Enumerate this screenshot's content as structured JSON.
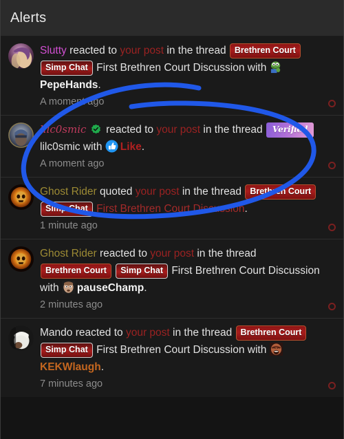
{
  "header": {
    "title": "Alerts"
  },
  "colors": {
    "background": "#1a1a1a",
    "header_background": "#2b2b2b",
    "text": "#e2e2e2",
    "muted_text": "#8c8c8c",
    "your_post_red": "#9b2222",
    "badge_brethren_red": "#a81d1d",
    "badge_verified_purple": "#b06fd6",
    "annotation_blue": "#2058e8",
    "unread_ring": "#7a2020"
  },
  "annotation": {
    "shape": "hand-drawn-ellipse",
    "color": "#2058e8",
    "targets_row_index": 1
  },
  "alerts": [
    {
      "id": "alert-1",
      "avatar_name": "avatar-slutty",
      "username": "Slutty",
      "username_color": "#d14fd1",
      "username_style": "pink",
      "verified": false,
      "action": "reacted to",
      "object": "your post",
      "in_thread": "in the thread",
      "badges": [
        {
          "label": "Brethren Court",
          "style": "brethren"
        },
        {
          "label": "Simp Chat",
          "style": "simp"
        }
      ],
      "thread_title": "First Brethren Court Discussion",
      "thread_title_color": "#e2e2e2",
      "with_word": "with",
      "reaction_emoji": "pepehands-emoji",
      "reaction_label": "PepeHands",
      "reaction_label_color": "#f2f2f2",
      "trailing_period": ".",
      "time": "A moment ago",
      "unread": true
    },
    {
      "id": "alert-2",
      "avatar_name": "avatar-lilc0smic",
      "username": "lilc0smic",
      "username_color": "#c23b5e",
      "username_style": "script",
      "verified": true,
      "action": "reacted to",
      "object": "your post",
      "in_thread": "in the thread",
      "badges": [
        {
          "label": "Verified",
          "style": "verified"
        }
      ],
      "thread_title": "lilc0smic",
      "thread_title_color": "#e2e2e2",
      "with_word": "with",
      "reaction_emoji": "thumbs-up-emoji",
      "reaction_label": "Like",
      "reaction_label_color": "#b02020",
      "trailing_period": ".",
      "time": "A moment ago",
      "unread": true
    },
    {
      "id": "alert-3",
      "avatar_name": "avatar-ghost-rider",
      "username": "Ghost Rider",
      "username_color": "#9c8a34",
      "username_style": "gold",
      "verified": false,
      "action": "quoted",
      "object": "your post",
      "in_thread": "in the thread",
      "badges": [
        {
          "label": "Brethren Court",
          "style": "brethren"
        },
        {
          "label": "Simp Chat",
          "style": "simp"
        }
      ],
      "thread_title": "First Brethren Court Discussion",
      "thread_title_color": "#a32a2a",
      "with_word": "",
      "reaction_emoji": "",
      "reaction_label": "",
      "reaction_label_color": "",
      "trailing_period": ".",
      "time": "1 minute ago",
      "unread": true
    },
    {
      "id": "alert-4",
      "avatar_name": "avatar-ghost-rider",
      "username": "Ghost Rider",
      "username_color": "#9c8a34",
      "username_style": "gold",
      "verified": false,
      "action": "reacted to",
      "object": "your post",
      "in_thread": "in the thread",
      "badges": [
        {
          "label": "Brethren Court",
          "style": "brethren"
        },
        {
          "label": "Simp Chat",
          "style": "simp"
        }
      ],
      "thread_title": "First Brethren Court Discussion",
      "thread_title_color": "#e2e2e2",
      "with_word": "with",
      "reaction_emoji": "pausechamp-emoji",
      "reaction_label": "pauseChamp",
      "reaction_label_color": "#f2f2f2",
      "trailing_period": ".",
      "time": "2 minutes ago",
      "unread": true
    },
    {
      "id": "alert-5",
      "avatar_name": "avatar-mando",
      "username": "Mando",
      "username_color": "#e2e2e2",
      "username_style": "plain",
      "verified": false,
      "action": "reacted to",
      "object": "your post",
      "in_thread": "in the thread",
      "badges": [
        {
          "label": "Brethren Court",
          "style": "brethren"
        },
        {
          "label": "Simp Chat",
          "style": "simp"
        }
      ],
      "thread_title": "First Brethren Court Discussion",
      "thread_title_color": "#e2e2e2",
      "with_word": "with",
      "reaction_emoji": "kekwlaugh-emoji",
      "reaction_label": "KEKWlaugh",
      "reaction_label_color": "#c4661f",
      "trailing_period": ".",
      "time": "7 minutes ago",
      "unread": true
    }
  ]
}
